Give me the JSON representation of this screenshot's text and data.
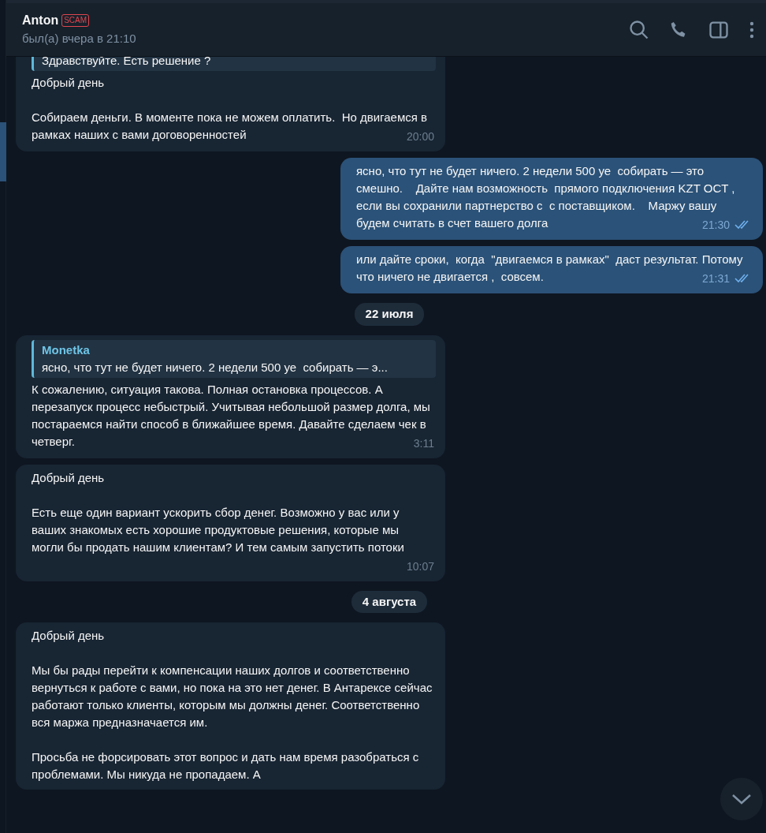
{
  "header": {
    "name": "Anton",
    "badge": "SCAM",
    "status": "был(а) вчера в 21:10"
  },
  "messages": [
    {
      "kind": "message",
      "outgoing": false,
      "reply": {
        "text": "Здравствуйте. Есть решение ?"
      },
      "paragraphs": [
        "Добрый день",
        "Собираем деньги. В моменте пока не можем оплатить.  Но двигаемся в рамках наших с вами договоренностей"
      ],
      "time": "20:00"
    },
    {
      "kind": "message",
      "outgoing": true,
      "paragraphs": [
        "ясно, что тут не будет ничего. 2 недели 500 уе  собирать — это смешно.    Дайте нам возможность  прямого подключения KZT OCT , если вы сохранили партнерство с  с поставщиком.    Маржу вашу  будем считать в счет вашего долга"
      ],
      "time": "21:30",
      "read": true
    },
    {
      "kind": "message",
      "outgoing": true,
      "paragraphs": [
        "или дайте сроки,  когда  \"двигаемся в рамках\"  даст результат. Потому что ничего не двигается ,  совсем."
      ],
      "time": "21:31",
      "read": true
    },
    {
      "kind": "date",
      "text": "22 июля"
    },
    {
      "kind": "message",
      "outgoing": false,
      "reply": {
        "author": "Monetka",
        "text": "ясно, что тут не будет ничего. 2 недели 500 уе  собирать — э..."
      },
      "paragraphs": [
        "К сожалению, ситуация такова. Полная остановка процессов. А перезапуск процесс небыстрый. Учитывая небольшой размер долга, мы постараемся найти способ в ближайшее время. Давайте сделаем чек в четверг."
      ],
      "time": "3:11"
    },
    {
      "kind": "message",
      "outgoing": false,
      "paragraphs": [
        "Добрый день",
        "Есть еще один вариант ускорить сбор денег. Возможно у вас или у ваших знакомых есть хорошие продуктовые решения, которые мы могли бы продать нашим клиентам? И тем самым запустить потоки"
      ],
      "time": "10:07"
    },
    {
      "kind": "date",
      "text": "4 августа"
    },
    {
      "kind": "message",
      "outgoing": false,
      "paragraphs": [
        "Добрый день",
        "Мы бы рады перейти к компенсации наших долгов и соответственно вернуться к работе с вами, но пока на это нет денег. В Антарексе сейчас работают только клиенты, которым мы должны денег. Соответственно вся маржа предназначается им.",
        "Просьба не форсировать этот вопрос и дать нам время разобраться с проблемами. Мы никуда не пропадаем. А"
      ]
    }
  ]
}
